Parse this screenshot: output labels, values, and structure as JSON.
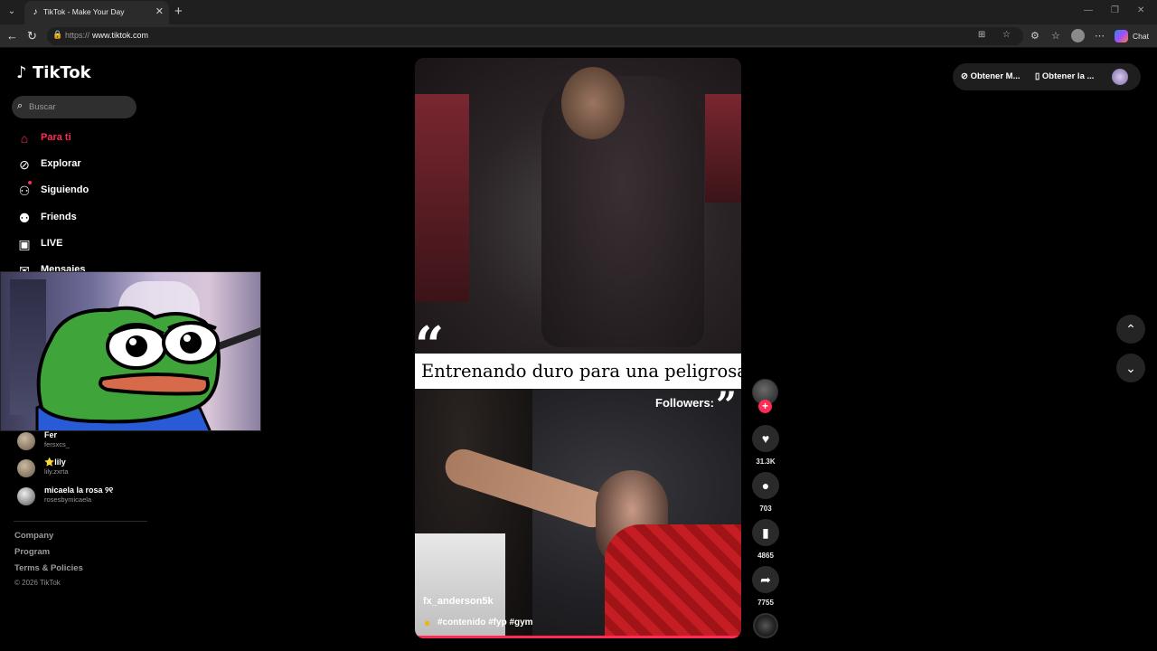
{
  "browser": {
    "tab_title": "TikTok - Make Your Day",
    "url_protocol": "https://",
    "url_host": "www.tiktok.com",
    "chat_label": "Chat"
  },
  "sidebar": {
    "logo": "TikTok",
    "search_placeholder": "Buscar",
    "nav": [
      {
        "label": "Para ti",
        "icon": "home-icon",
        "active": true
      },
      {
        "label": "Explorar",
        "icon": "compass-icon"
      },
      {
        "label": "Siguiendo",
        "icon": "following-icon"
      },
      {
        "label": "Friends",
        "icon": "friends-icon"
      },
      {
        "label": "LIVE",
        "icon": "live-icon"
      },
      {
        "label": "Mensajes",
        "icon": "message-icon"
      }
    ],
    "following_accounts": [
      {
        "name": "Fer",
        "handle": "fersxcs_"
      },
      {
        "name": "⭐lily",
        "handle": "lily.zxrta"
      },
      {
        "name": "micaela la rosa ୨୧",
        "handle": "rosesbymicaela"
      }
    ],
    "footer_links": [
      "Company",
      "Program",
      "Terms & Policies"
    ],
    "copyright": "© 2026 TikTok"
  },
  "video": {
    "caption_overlay": "Entrenando duro para una peligrosa asi:",
    "followers_overlay": "Followers:",
    "author": "fx_anderson5k",
    "hashtags": "#contenido #fyp #gym",
    "progress": 1.0
  },
  "actions": {
    "likes": "31.3K",
    "comments": "703",
    "saves": "4865",
    "shares": "7755"
  },
  "top_right": {
    "button1": "Obtener M...",
    "button2": "Obtener la ..."
  },
  "colors": {
    "accent": "#fe2c55",
    "background": "#000000"
  }
}
